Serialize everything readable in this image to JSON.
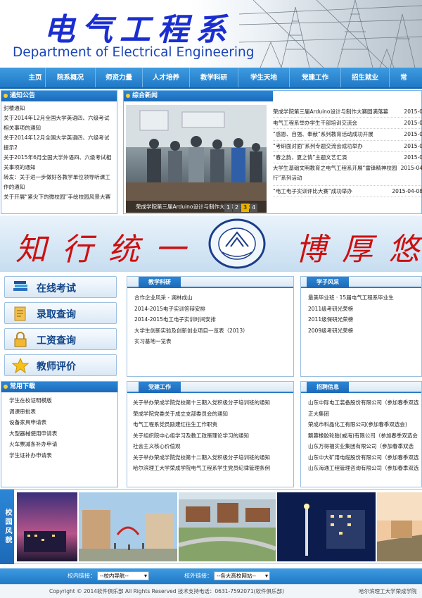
{
  "header": {
    "title_cn": "电气工程系",
    "title_en": "Department of Electrical Engineering"
  },
  "nav": {
    "items": [
      "主页",
      "院系概况",
      "师资力量",
      "人才培养",
      "教学科研",
      "学生天地",
      "党建工作",
      "招生就业",
      "常"
    ]
  },
  "notice": {
    "title": "通知公告",
    "items": [
      "封楼通知",
      "关于2014年12月全国大学英语四、六级考试相关事项的通知",
      "关于2014年12月全国大学英语四、六级考试提示2",
      "关于2015年6月全国大学外语四、六级考试相关事项的通知",
      "转发：关于进一步做好各教学单位领导听课工作的通知",
      "关于开展“紧尖下的微校园”手绘校园风景大赛"
    ]
  },
  "news": {
    "title": "综合新闻",
    "photo_caption": "荣成学院第三届Arduino设计与制作大赛圆满落幕",
    "pager": [
      "1",
      "2",
      "3",
      "4"
    ],
    "active_page": "3",
    "items": [
      {
        "title": "荣成学院第三届Arduino设计与制作大赛圆满落幕",
        "date": "2015-0"
      },
      {
        "title": "电气工程系举办学生干部培训交流会",
        "date": "2015-0"
      },
      {
        "title": "“感恩、自强、奉献”系列教育活动成功开展",
        "date": "2015-0"
      },
      {
        "title": "“考研面对面”系列专题交流会成功举办",
        "date": "2015-0"
      },
      {
        "title": "“春之韵，夏之情”主题文艺汇演",
        "date": "2015-0"
      },
      {
        "title": "大学生基础文明教育之电气工程系开展“雷锋精神校园行”系列活动",
        "date": "2015-04"
      },
      {
        "title": "“电工电子实训评比大赛”成功举办",
        "date": "2015-04-08"
      }
    ]
  },
  "banner": {
    "motto_left": "知行统一",
    "motto_right": "博厚悠",
    "seal_text": "HARBIN UNIVERSITY OF SCIENCE AND TECHNOLOGY"
  },
  "quick_links": [
    {
      "label": "在线考试",
      "icon": "books-icon"
    },
    {
      "label": "录取查询",
      "icon": "document-icon"
    },
    {
      "label": "工资查询",
      "icon": "lock-icon"
    },
    {
      "label": "教师评价",
      "icon": "star-icon"
    }
  ],
  "teaching": {
    "title": "教学科研",
    "items": [
      "合作企业风采 - 澜林成山",
      "2014-2015电子实训答辩安排",
      "2014-2015电工电子实训时间安排",
      "大学生创新实验及创新创业项目一览表（2013）",
      "实习基地一览表"
    ]
  },
  "style": {
    "title": "学子风采",
    "items": [
      "最美毕业班 · 15届电气工程系毕业生",
      "2011级考研光荣榜",
      "2011级保研光荣榜",
      "2009级考研光荣榜"
    ]
  },
  "downloads": {
    "title": "常用下载",
    "items": [
      "学生在校证明模版",
      "调课审批表",
      "设备家具申请表",
      "大型器械使用申请表",
      "火车票减条补办申请",
      "学生证补办申请表"
    ]
  },
  "party": {
    "title": "党建工作",
    "items": [
      "关于举办荣成学院党校第十三期入党积极分子培训班的通知",
      "荣成学院党委关于成立支部委员会的通知",
      "电气工程系党员励建红往生工作职责",
      "关于组织院中心组学习及教工政策理论学习的通知",
      "社会主义核心价值观",
      "关于举办荣成学院党校第十二期入党积极分子培训班的通知",
      "哈尔滨理工大学荣成学院电气工程系学生党员纪律管理条例"
    ]
  },
  "recruit": {
    "title": "招聘信息",
    "items": [
      "山东中际电工装备股份有限公司（参加春季双选",
      "正大集团",
      "荣成市科晶化工有限公司(参加春季双选会)",
      "飘蓉橡胶轮胎(威海)有限公司（参加春季双选会",
      "山东万得福实业集团有限公司（参加春季双选",
      "山东中大矿用电缆股份有限公司（参加春季双选",
      "山东海通工程管理咨询有限公司（参加春季双选"
    ]
  },
  "gallery": {
    "label": "校园风貌"
  },
  "links_bar": {
    "internal_label": "校内链接：",
    "internal_value": "--校内导航--",
    "external_label": "校外链接：",
    "external_value": "--各大高校网站--"
  },
  "footer": {
    "copyright": "Copyright © 2014软件俱乐部 All Rights Reserved 技术支持电话：0631-7592071(软件俱乐部)",
    "school": "哈尔滨理工大学荣成学院"
  }
}
